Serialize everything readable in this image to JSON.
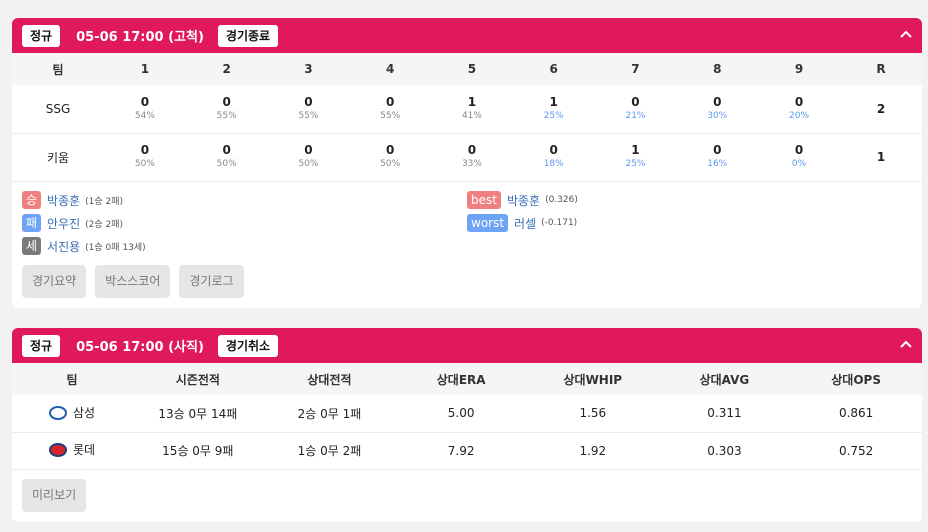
{
  "game1": {
    "type_badge": "정규",
    "title": "05-06 17:00 (고척)",
    "status": "경기종료",
    "header_team": "팀",
    "innings": [
      "1",
      "2",
      "3",
      "4",
      "5",
      "6",
      "7",
      "8",
      "9"
    ],
    "runs_label": "R",
    "rows": [
      {
        "team": "SSG",
        "scores": [
          "0",
          "0",
          "0",
          "0",
          "1",
          "1",
          "0",
          "0",
          "0"
        ],
        "pcts": [
          "54%",
          "55%",
          "55%",
          "55%",
          "41%",
          "25%",
          "21%",
          "30%",
          "20%"
        ],
        "pct_highlight": [
          false,
          false,
          false,
          false,
          false,
          true,
          true,
          true,
          true
        ],
        "runs": "2"
      },
      {
        "team": "키움",
        "scores": [
          "0",
          "0",
          "0",
          "0",
          "0",
          "0",
          "1",
          "0",
          "0"
        ],
        "pcts": [
          "50%",
          "50%",
          "50%",
          "50%",
          "33%",
          "18%",
          "25%",
          "16%",
          "0%"
        ],
        "pct_highlight": [
          false,
          false,
          false,
          false,
          false,
          true,
          true,
          true,
          true
        ],
        "runs": "1"
      }
    ],
    "pitchers": [
      {
        "tag": "승",
        "name": "박종훈",
        "record": "(1승 2패)"
      },
      {
        "tag": "패",
        "name": "안우진",
        "record": "(2승 2패)"
      },
      {
        "tag": "세",
        "name": "서진용",
        "record": "(1승 0패 13세)"
      }
    ],
    "players": [
      {
        "tag": "best",
        "name": "박종훈",
        "record": "(0.326)"
      },
      {
        "tag": "worst",
        "name": "러셀",
        "record": "(-0.171)"
      }
    ],
    "buttons": [
      "경기요약",
      "박스스코어",
      "경기로그"
    ]
  },
  "game2": {
    "type_badge": "정규",
    "title": "05-06 17:00 (사직)",
    "status": "경기취소",
    "headers": [
      "팀",
      "시즌전적",
      "상대전적",
      "상대ERA",
      "상대WHIP",
      "상대AVG",
      "상대OPS"
    ],
    "rows": [
      {
        "team": "삼성",
        "logo": "samsung-logo",
        "season": "13승 0무 14패",
        "h2h": "2승 0무 1패",
        "era": "5.00",
        "whip": "1.56",
        "avg": "0.311",
        "ops": "0.861"
      },
      {
        "team": "롯데",
        "logo": "lotte-logo",
        "season": "15승 0무 9패",
        "h2h": "1승 0무 2패",
        "era": "7.92",
        "whip": "1.92",
        "avg": "0.303",
        "ops": "0.752"
      }
    ],
    "preview_button": "미리보기"
  },
  "colors": {
    "accent": "#e0195c",
    "win": "#f08080",
    "loss": "#6fa3f5",
    "save": "#7a7a7a",
    "link": "#3a6fb7"
  }
}
